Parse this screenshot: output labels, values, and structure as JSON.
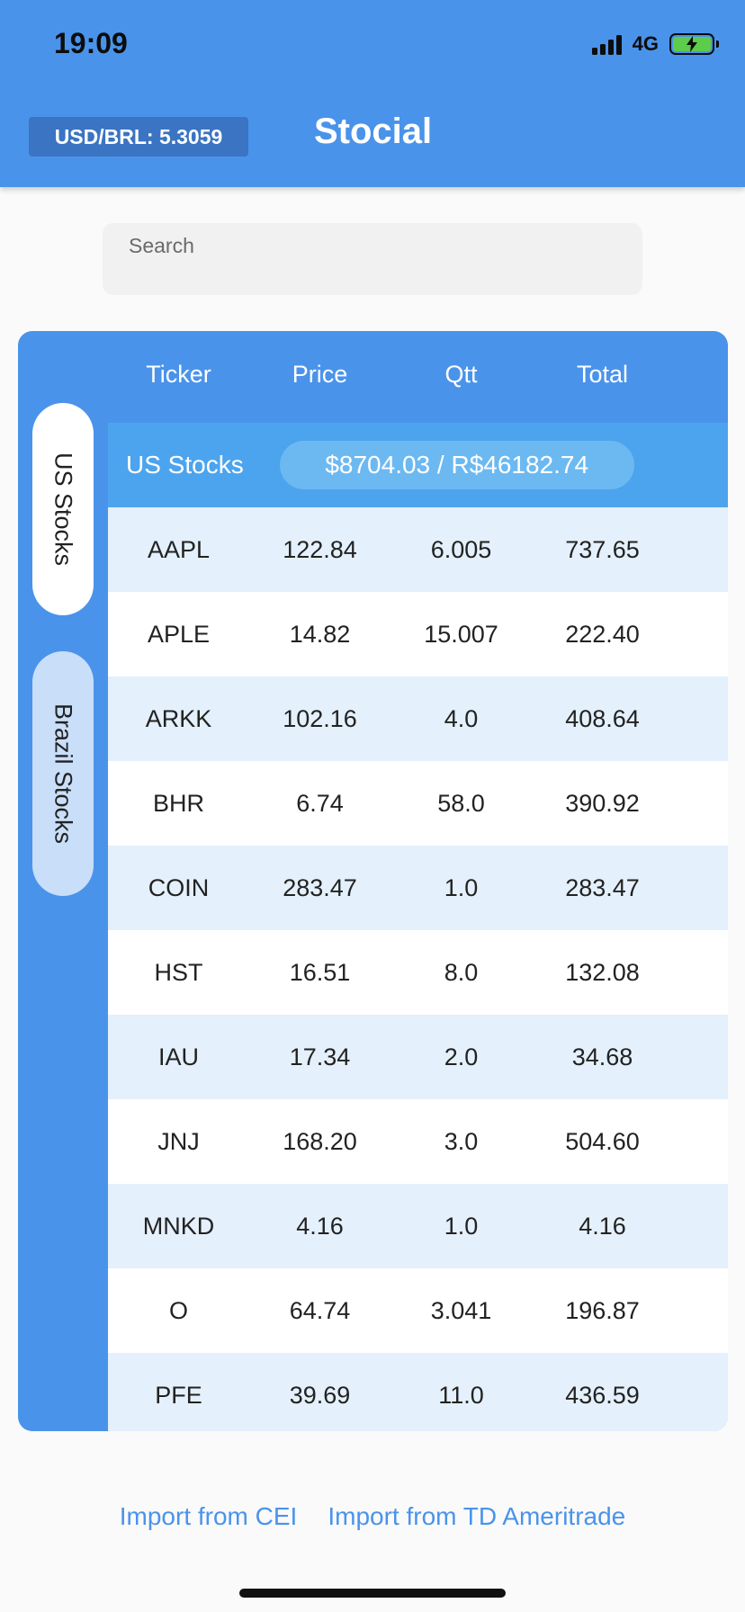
{
  "status_bar": {
    "time": "19:09",
    "network": "4G"
  },
  "header": {
    "exchange_rate": "USD/BRL: 5.3059",
    "title": "Stocial"
  },
  "search": {
    "label": "Search",
    "value": ""
  },
  "table": {
    "columns": [
      "Ticker",
      "Price",
      "Qtt",
      "Total"
    ],
    "tabs": [
      {
        "label": "US Stocks",
        "selected": true
      },
      {
        "label": "Brazil Stocks",
        "selected": false
      }
    ],
    "section": {
      "title": "US Stocks",
      "total": "$8704.03 / R$46182.74"
    },
    "rows": [
      {
        "ticker": "AAPL",
        "price": "122.84",
        "qtt": "6.005",
        "total": "737.65"
      },
      {
        "ticker": "APLE",
        "price": "14.82",
        "qtt": "15.007",
        "total": "222.40"
      },
      {
        "ticker": "ARKK",
        "price": "102.16",
        "qtt": "4.0",
        "total": "408.64"
      },
      {
        "ticker": "BHR",
        "price": "6.74",
        "qtt": "58.0",
        "total": "390.92"
      },
      {
        "ticker": "COIN",
        "price": "283.47",
        "qtt": "1.0",
        "total": "283.47"
      },
      {
        "ticker": "HST",
        "price": "16.51",
        "qtt": "8.0",
        "total": "132.08"
      },
      {
        "ticker": "IAU",
        "price": "17.34",
        "qtt": "2.0",
        "total": "34.68"
      },
      {
        "ticker": "JNJ",
        "price": "168.20",
        "qtt": "3.0",
        "total": "504.60"
      },
      {
        "ticker": "MNKD",
        "price": "4.16",
        "qtt": "1.0",
        "total": "4.16"
      },
      {
        "ticker": "O",
        "price": "64.74",
        "qtt": "3.041",
        "total": "196.87"
      },
      {
        "ticker": "PFE",
        "price": "39.69",
        "qtt": "11.0",
        "total": "436.59"
      }
    ]
  },
  "footer": {
    "import_cei": "Import from CEI",
    "import_td": "Import from TD Ameritrade"
  },
  "colors": {
    "primary": "#4a93ea",
    "section_header": "#4ca4ee",
    "row_alt": "#e4f0fb",
    "battery": "#5ccc4a"
  }
}
